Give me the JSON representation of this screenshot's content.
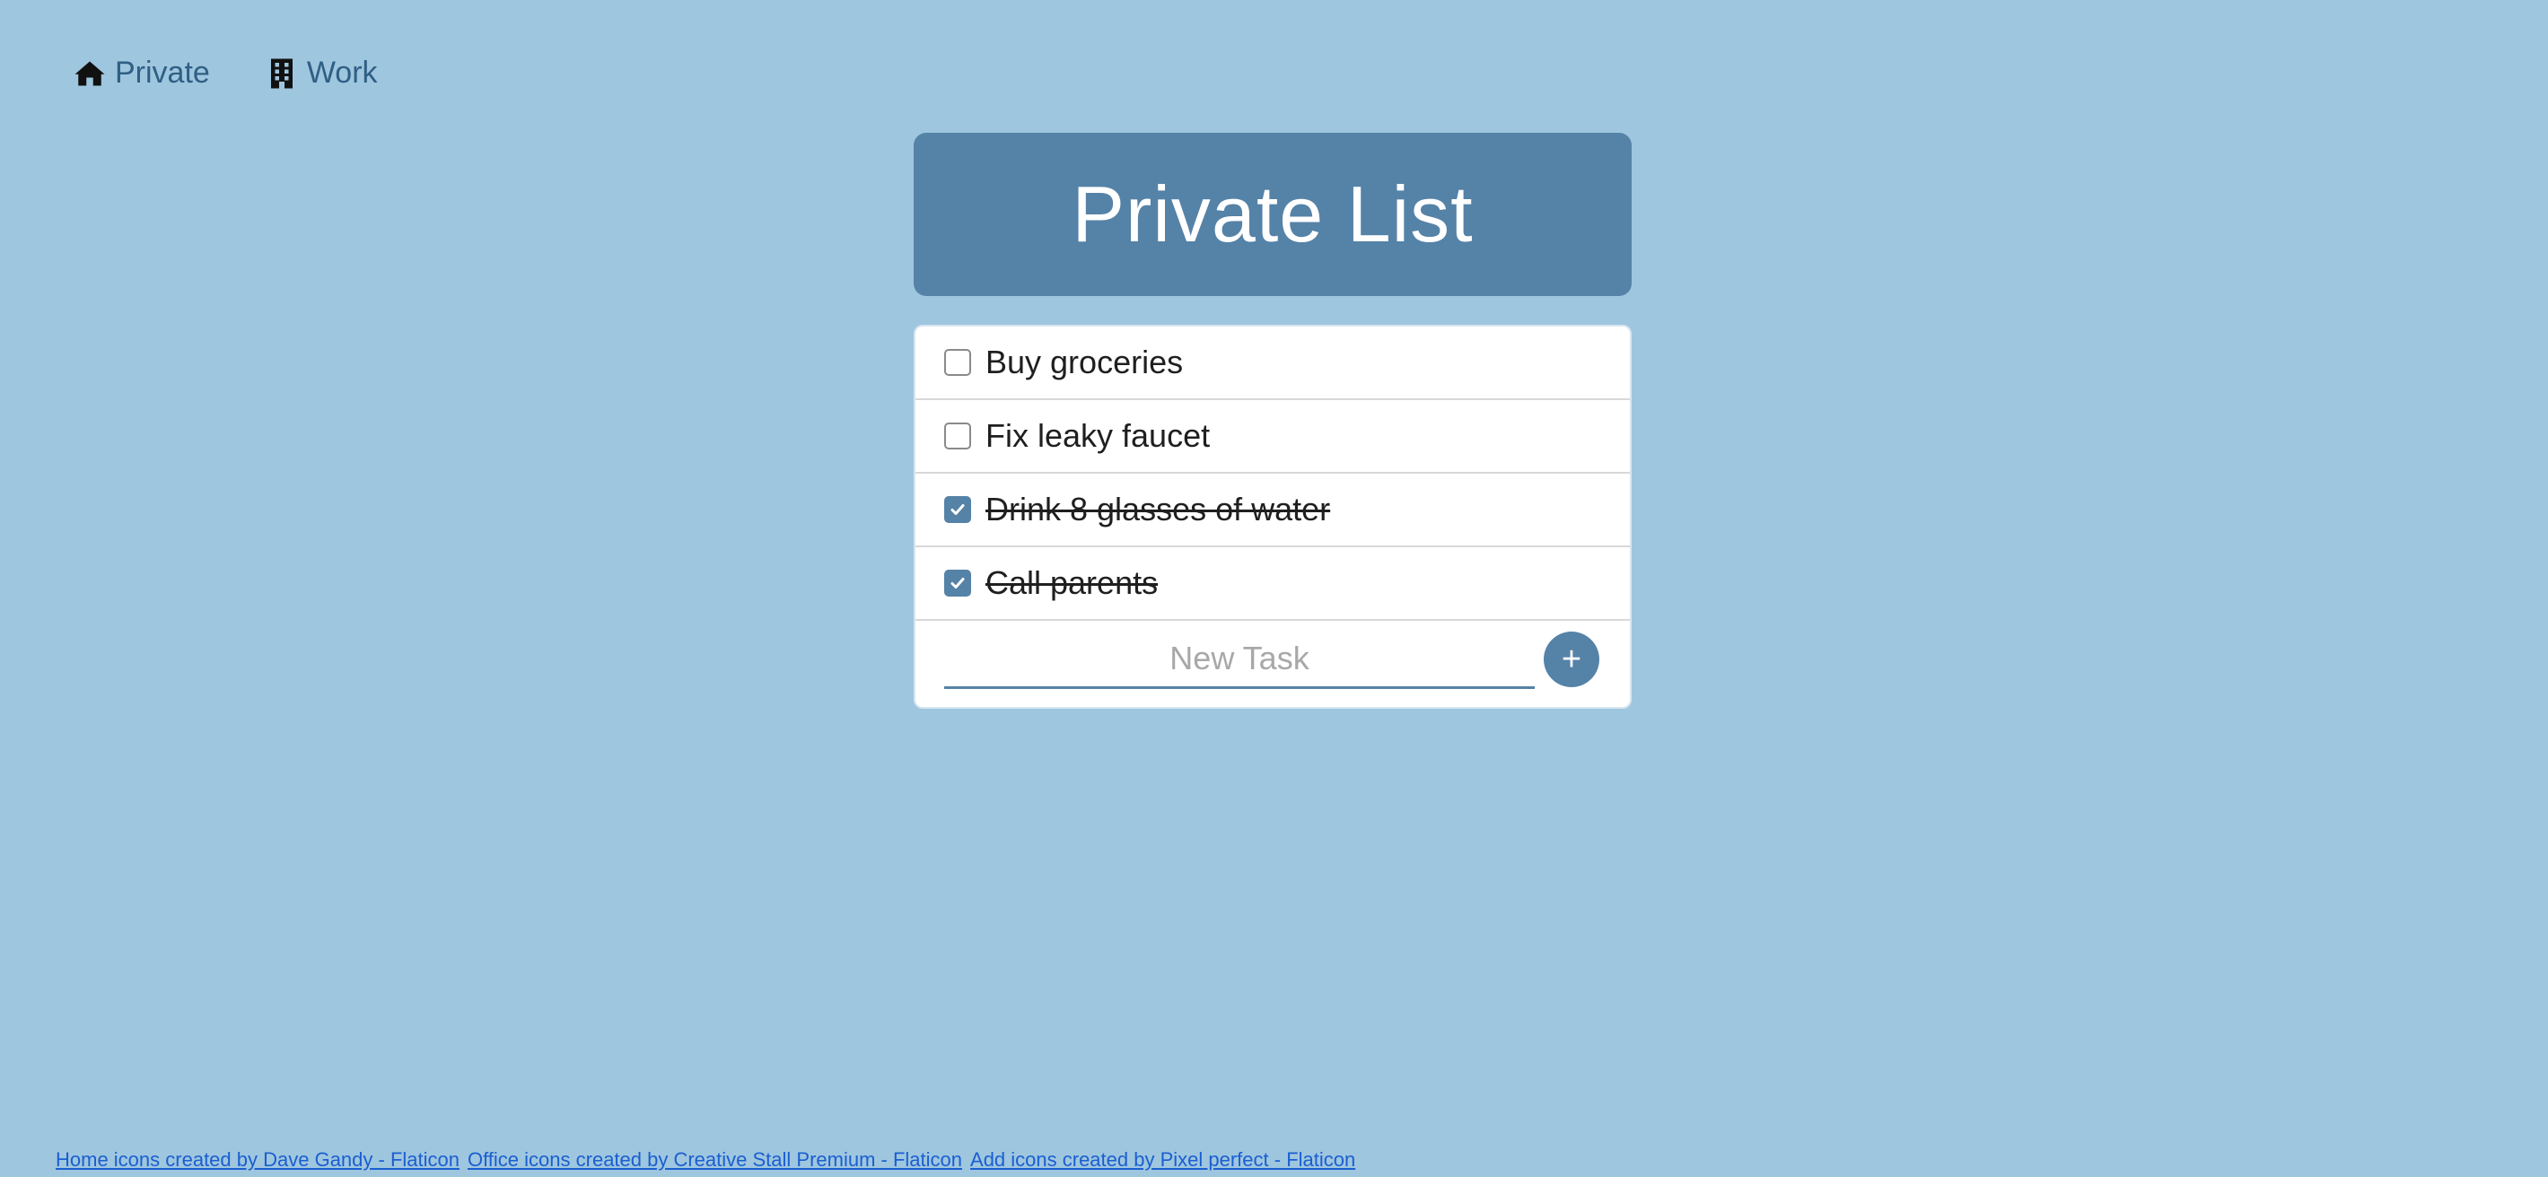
{
  "nav": {
    "items": [
      {
        "label": "Private",
        "icon": "home-icon"
      },
      {
        "label": "Work",
        "icon": "office-building-icon"
      }
    ]
  },
  "header": {
    "title": "Private List"
  },
  "tasks": [
    {
      "label": "Buy groceries",
      "done": false
    },
    {
      "label": "Fix leaky faucet",
      "done": false
    },
    {
      "label": "Drink 8 glasses of water",
      "done": true
    },
    {
      "label": "Call parents",
      "done": true
    }
  ],
  "new_task": {
    "placeholder": "New Task",
    "value": "",
    "add_label": "+"
  },
  "footer": {
    "links": [
      "Home icons created by Dave Gandy - Flaticon",
      "Office icons created by Creative Stall Premium - Flaticon",
      "Add icons created by Pixel perfect - Flaticon"
    ]
  },
  "colors": {
    "background": "#9fc6df",
    "accent": "#5582a7",
    "link": "#1a5fd0"
  }
}
